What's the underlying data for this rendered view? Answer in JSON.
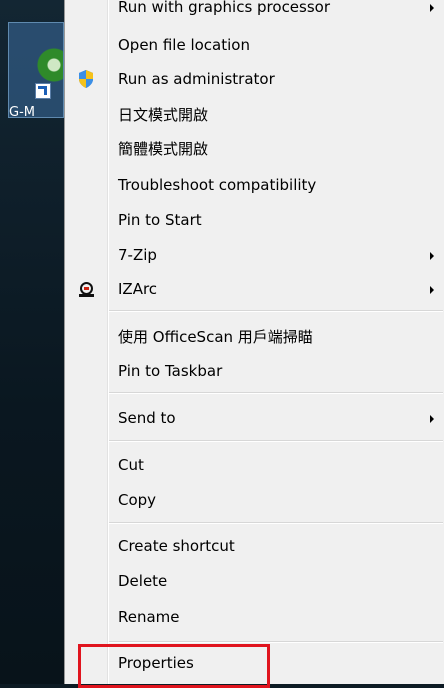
{
  "desktop": {
    "icon_label": "G-M"
  },
  "menu": {
    "items": [
      {
        "label": "Run with graphics processor",
        "submenu": true
      },
      {
        "label": "Open file location",
        "submenu": false
      },
      {
        "label": "Run as administrator",
        "submenu": false,
        "icon": "uac-shield-icon"
      },
      {
        "label": "日文模式開啟",
        "submenu": false
      },
      {
        "label": "簡體模式開啟",
        "submenu": false
      },
      {
        "label": "Troubleshoot compatibility",
        "submenu": false
      },
      {
        "label": "Pin to Start",
        "submenu": false
      },
      {
        "label": "7-Zip",
        "submenu": true
      },
      {
        "label": "IZArc",
        "submenu": true,
        "icon": "izarc-icon"
      },
      {
        "label": "使用 OfficeScan 用戶端掃瞄",
        "submenu": false
      },
      {
        "label": "Pin to Taskbar",
        "submenu": false
      },
      {
        "label": "Send to",
        "submenu": true
      },
      {
        "label": "Cut",
        "submenu": false
      },
      {
        "label": "Copy",
        "submenu": false
      },
      {
        "label": "Create shortcut",
        "submenu": false
      },
      {
        "label": "Delete",
        "submenu": false
      },
      {
        "label": "Rename",
        "submenu": false
      },
      {
        "label": "Properties",
        "submenu": false
      }
    ]
  },
  "colors": {
    "menu_background": "#f0f0f0",
    "highlight_border": "#e0141e",
    "desktop_background": "#0d1b24"
  }
}
